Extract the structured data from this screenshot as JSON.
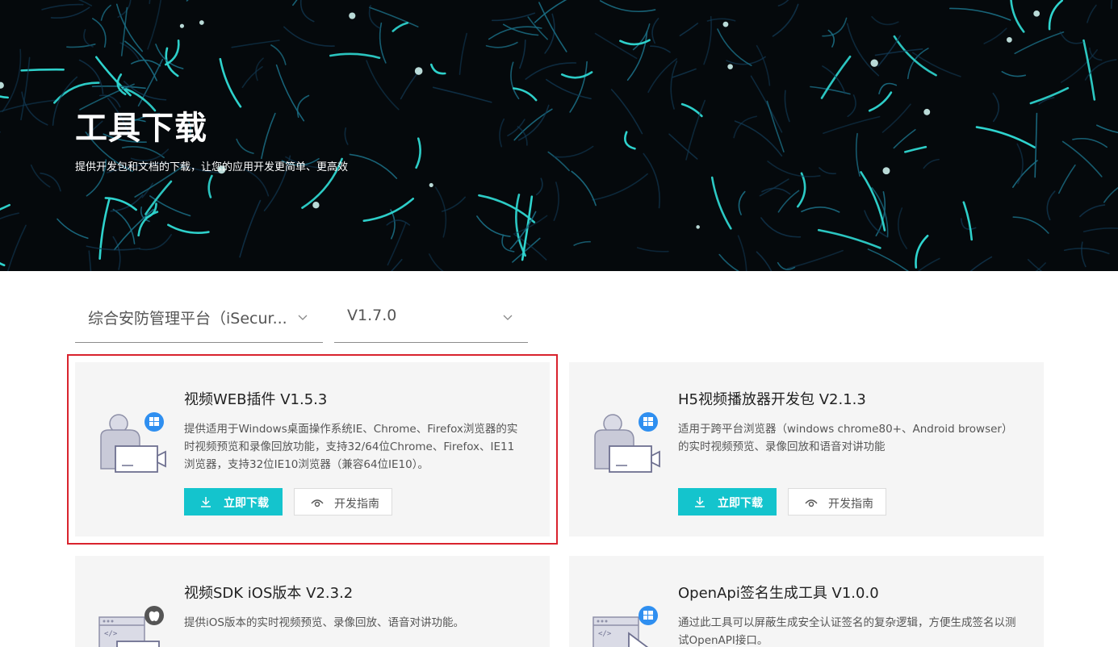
{
  "hero": {
    "title": "工具下载",
    "subtitle": "提供开发包和文档的下载，让您的应用开发更简单、更高效"
  },
  "filters": {
    "platform": "综合安防管理平台（iSecur...",
    "version": "V1.7.0"
  },
  "cards": [
    {
      "title": "视频WEB插件 V1.5.3",
      "description": "提供适用于Windows桌面操作系统IE、Chrome、Firefox浏览器的实时视频预览和录像回放功能，支持32/64位Chrome、Firefox、IE11浏览器，支持32位IE10浏览器（兼容64位IE10）。",
      "download_label": "立即下载",
      "guide_label": "开发指南",
      "badge": "windows-icon",
      "selected": true
    },
    {
      "title": "H5视频播放器开发包 V2.1.3",
      "description": "适用于跨平台浏览器（windows chrome80+、Android browser）的实时视频预览、录像回放和语音对讲功能",
      "download_label": "立即下载",
      "guide_label": "开发指南",
      "badge": "windows-icon",
      "selected": false
    },
    {
      "title": "视频SDK iOS版本 V2.3.2",
      "description": "提供iOS版本的实时视频预览、录像回放、语音对讲功能。",
      "badge": "apple-icon",
      "selected": false
    },
    {
      "title": "OpenApi签名生成工具 V1.0.0",
      "description": "通过此工具可以屏蔽生成安全认证签名的复杂逻辑，方便生成签名以测试OpenAPI接口。",
      "badge": "windows-icon",
      "selected": false
    }
  ],
  "colors": {
    "accent": "#14c4cd",
    "selected_border": "#d9232d",
    "card_bg": "#f5f5f5",
    "hero_bg": "#05090c"
  }
}
